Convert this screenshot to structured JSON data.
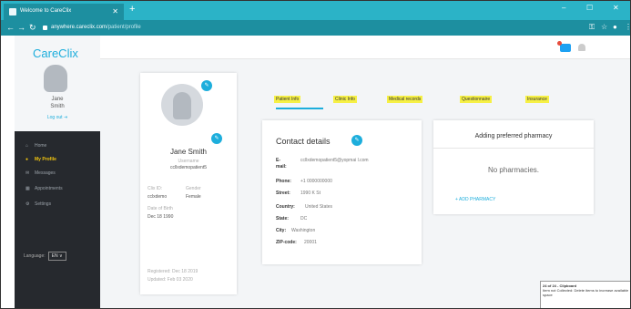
{
  "browser": {
    "tab_title": "Welcome to CareClix",
    "new_tab": "+",
    "url_host": "anywhere.careclix.com",
    "url_path": "/patient/profile",
    "win_min": "–",
    "win_max": "☐",
    "win_close": "✕"
  },
  "sidebar": {
    "logo": "CareClix",
    "user_first": "Jane",
    "user_last": "Smith",
    "logout": "Log out",
    "menu": [
      {
        "icon": "⌂",
        "label": "Home"
      },
      {
        "icon": "●",
        "label": "My Profile"
      },
      {
        "icon": "✉",
        "label": "Messages"
      },
      {
        "icon": "▦",
        "label": "Appointments"
      },
      {
        "icon": "⚙",
        "label": "Settings"
      }
    ],
    "language_label": "Language:",
    "language_value": "EN ∨"
  },
  "profile": {
    "name": "Jane Smith",
    "username_label": "Username",
    "username": "ccllxdemopatient5",
    "clixid_label": "Clix ID:",
    "clixid": "cclxdemo",
    "gender_label": "Gender",
    "gender": "Female",
    "dob_label": "Date of Birth",
    "dob": "Dec 18 1990",
    "registered": "Registered: Dec 18 2019",
    "updated": "Updated: Feb 03 2020"
  },
  "tabs": [
    "Patient Info",
    "Clinic Info",
    "Medical records",
    "Questionnaire",
    "Insurance"
  ],
  "contact": {
    "title": "Contact details",
    "email_label": "E-mail:",
    "email": "ccllxdemopatient5@yopmai l.com",
    "phone_label": "Phone:",
    "phone": "+1 0000000000",
    "street_label": "Street:",
    "street": "1990 K St",
    "country_label": "Country:",
    "country": "United States",
    "state_label": "State:",
    "state": "DC",
    "city_label": "City:",
    "city": "Washington",
    "zip_label": "ZIP-code:",
    "zip": "20001"
  },
  "pharmacy": {
    "title": "Adding preferred pharmacy",
    "empty": "No pharmacies.",
    "add": "+ ADD PHARMACY"
  },
  "clipboard": {
    "title": "24 of 24 - Clipboard",
    "body": "Item not Collected: Delete items to increase available space"
  }
}
